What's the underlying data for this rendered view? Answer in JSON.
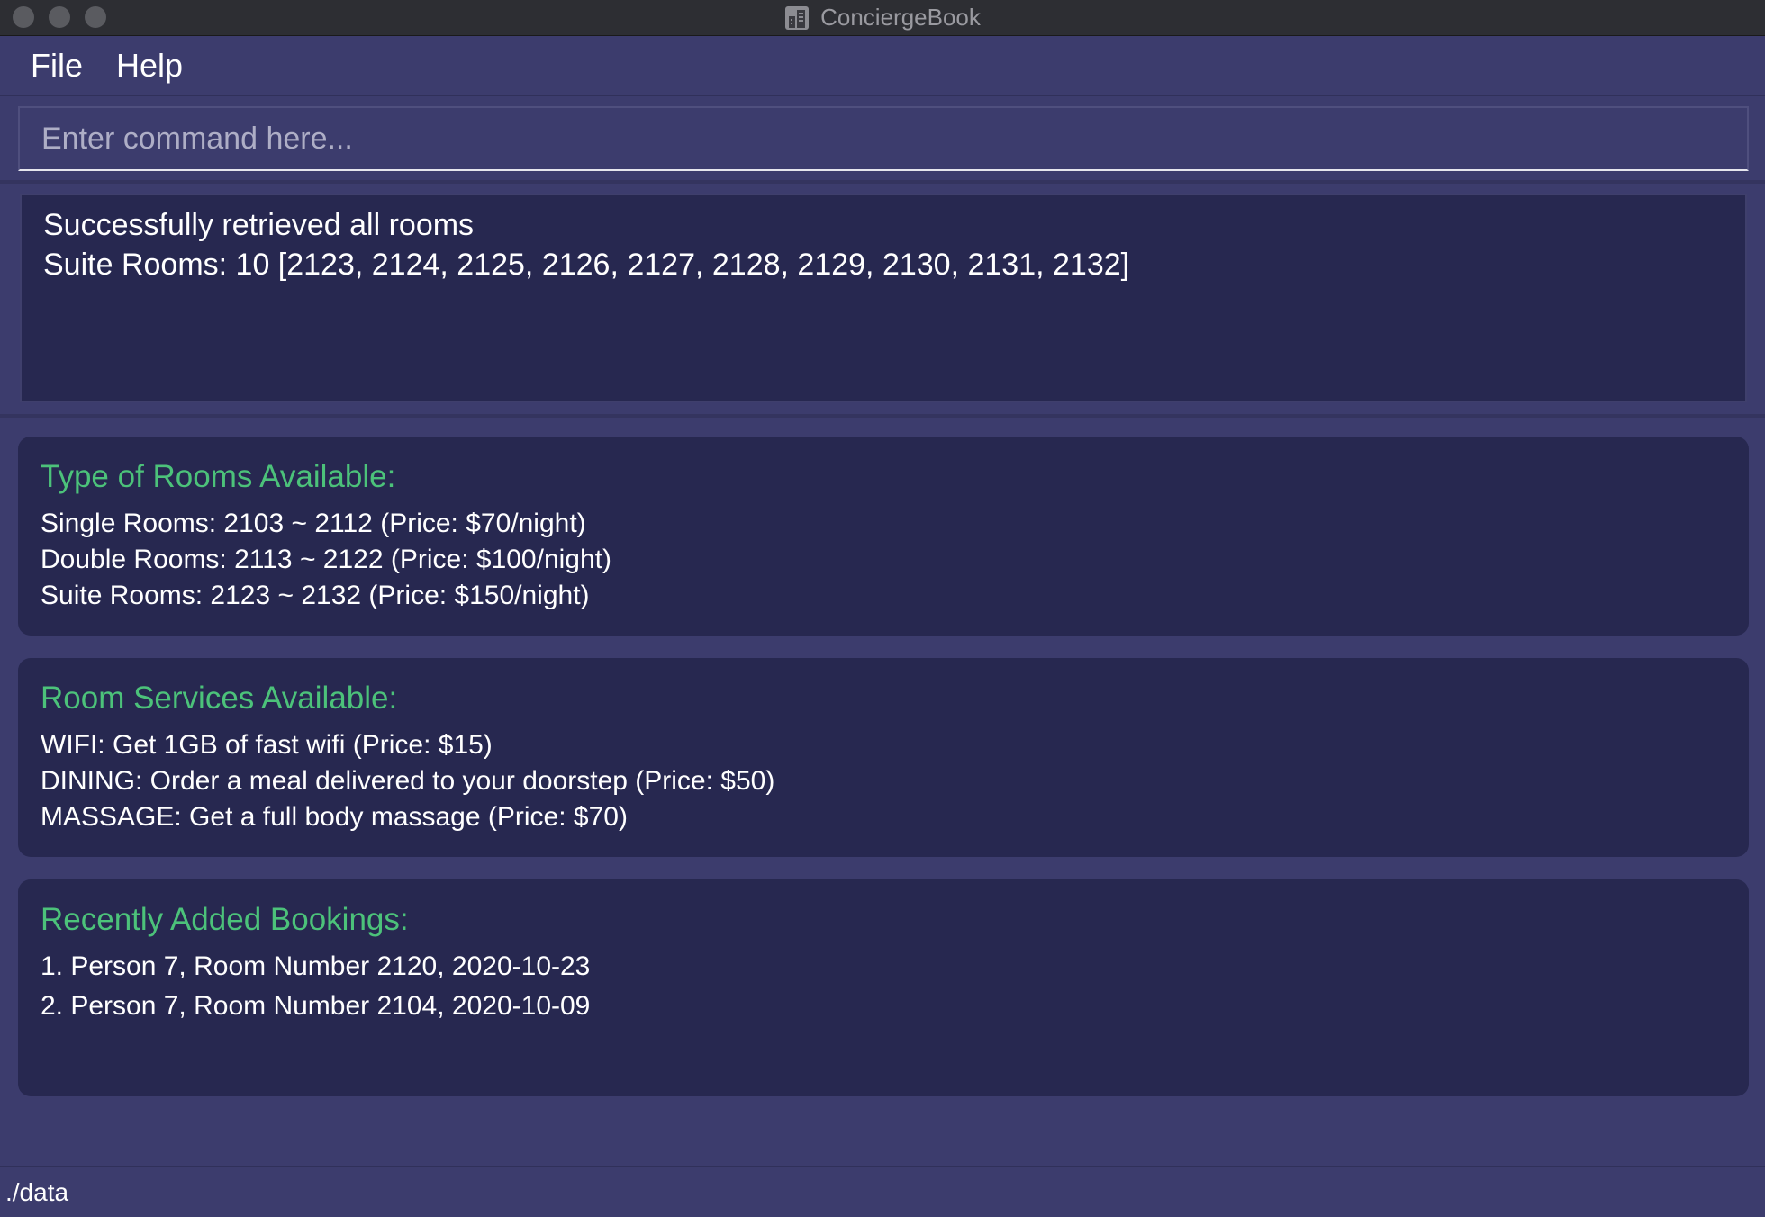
{
  "window": {
    "title": "ConciergeBook",
    "app_icon": "building-icon"
  },
  "menu": {
    "items": [
      {
        "label": "File"
      },
      {
        "label": "Help"
      }
    ]
  },
  "command": {
    "placeholder": "Enter command here...",
    "value": ""
  },
  "result": {
    "lines": [
      "Successfully retrieved all rooms",
      "Suite Rooms: 10 [2123, 2124, 2125, 2126, 2127, 2128, 2129, 2130, 2131, 2132]"
    ]
  },
  "rooms_panel": {
    "title": "Type of Rooms Available:",
    "lines": [
      "Single Rooms: 2103 ~ 2112 (Price: $70/night)",
      "Double Rooms: 2113 ~ 2122 (Price: $100/night)",
      "Suite Rooms: 2123 ~ 2132 (Price: $150/night)"
    ]
  },
  "services_panel": {
    "title": "Room Services Available:",
    "lines": [
      "WIFI: Get 1GB of fast wifi (Price: $15)",
      "DINING: Order a meal delivered to your doorstep (Price: $50)",
      "MASSAGE: Get a full body massage (Price: $70)"
    ]
  },
  "bookings_panel": {
    "title": "Recently Added Bookings:",
    "lines": [
      "1. Person 7, Room Number 2120, 2020-10-23",
      "2. Person 7, Room Number 2104, 2020-10-09"
    ]
  },
  "status": {
    "path": "./data"
  },
  "colors": {
    "background": "#3c3c6d",
    "panel": "#272850",
    "heading_accent": "#4cc27a",
    "text": "#ffffff"
  }
}
